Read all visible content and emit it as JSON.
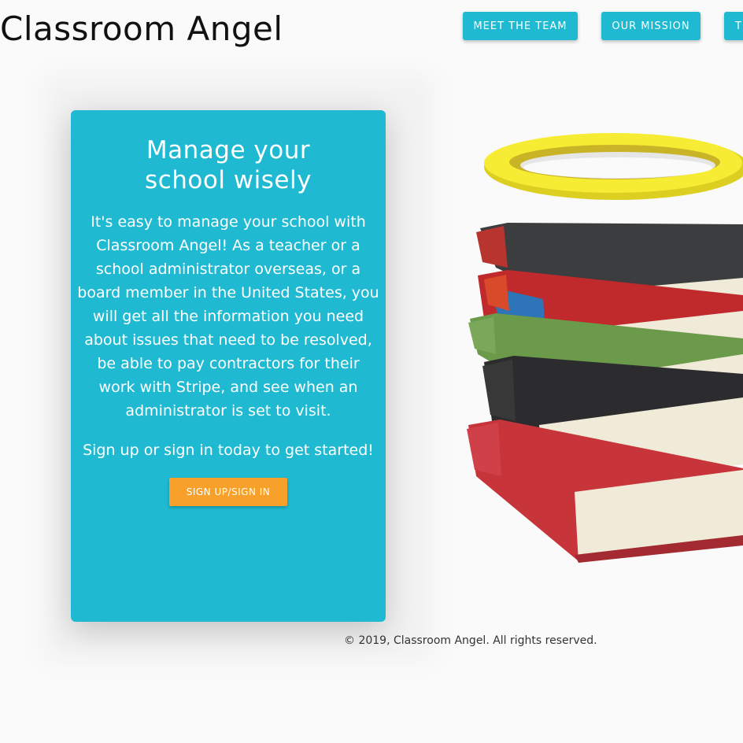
{
  "header": {
    "brand": "Classroom Angel",
    "nav": [
      {
        "label": "MEET THE TEAM"
      },
      {
        "label": "OUR MISSION"
      },
      {
        "label": "T"
      }
    ]
  },
  "card": {
    "title_line1": "Manage your",
    "title_line2": "school wisely",
    "body": "It's easy to manage your school with Classroom Angel! As a teacher or a school administrator overseas, or a board member in the United States, you will get all the information you need about issues that need to be resolved, be able to pay contractors for their work with Stripe, and see when an administrator is set to visit.",
    "cta": "Sign up or sign in today to get started!",
    "button_label": "SIGN UP/SIGN IN"
  },
  "footer": {
    "text": "© 2019, Classroom Angel. All rights reserved."
  },
  "hero": {
    "image": "stack-of-books-with-halo"
  },
  "colors": {
    "primary": "#1fbad2",
    "accent": "#f7a02a",
    "halo": "#f5ec33",
    "background": "#fafafa"
  }
}
